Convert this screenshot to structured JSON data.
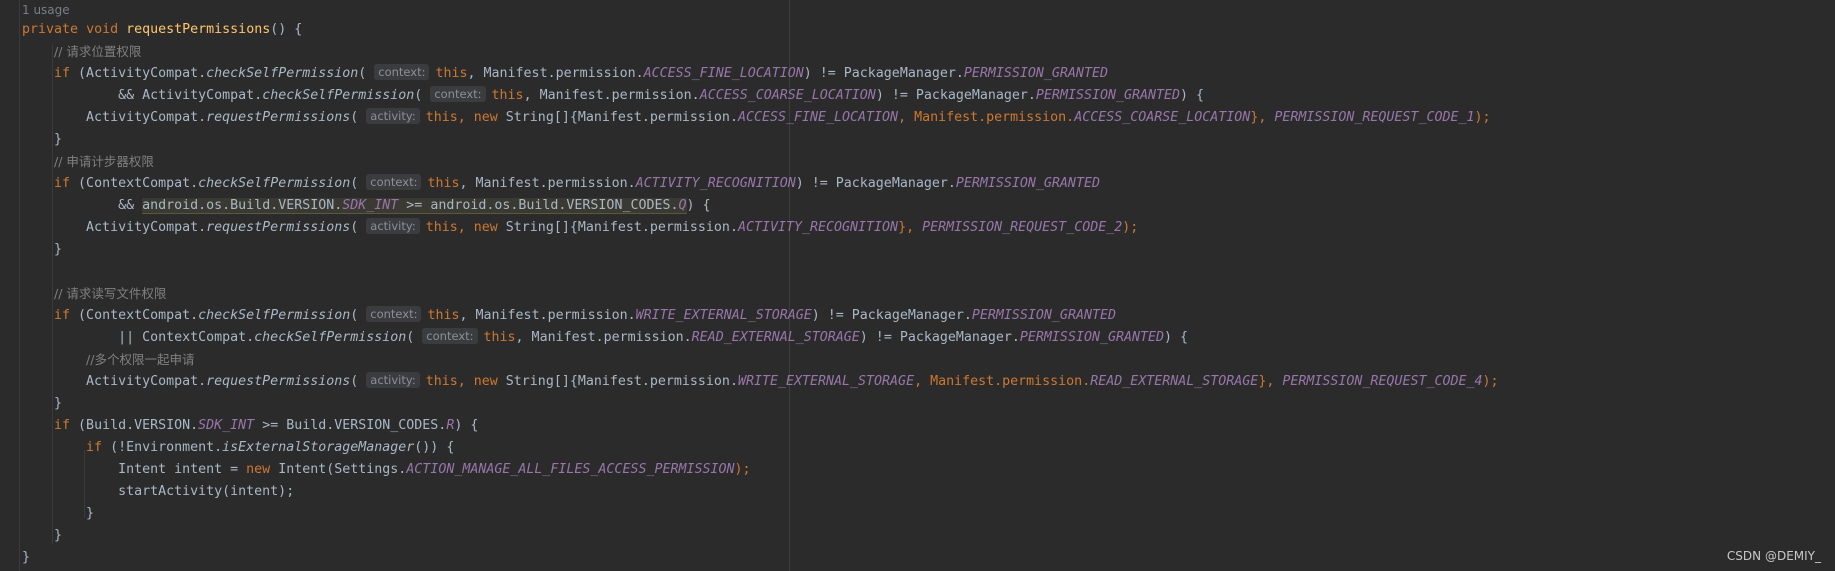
{
  "editor": {
    "usage_hint": "1 usage",
    "watermark": "CSDN @DEMIY_"
  },
  "code": {
    "l1": {
      "kw1": "private",
      "sp1": " ",
      "kw2": "void",
      "sp2": " ",
      "fn": "requestPermissions",
      "rest": "() {"
    },
    "l2": {
      "indent": "    ",
      "comment": "// 请求位置权限"
    },
    "l3": {
      "indent": "    ",
      "kw": "if",
      "t1": " (ActivityCompat.",
      "m1": "checkSelfPermission",
      "t2": "( ",
      "hint": "context:",
      "kw2": "this",
      "t3": ", Manifest.permission.",
      "c1": "ACCESS_FINE_LOCATION",
      "t4": ") != PackageManager.",
      "c2": "PERMISSION_GRANTED"
    },
    "l4": {
      "indent": "            ",
      "t1": "&& ActivityCompat.",
      "m1": "checkSelfPermission",
      "t2": "( ",
      "hint": "context:",
      "kw2": "this",
      "t3": ", Manifest.permission.",
      "c1": "ACCESS_COARSE_LOCATION",
      "t4": ") != PackageManager.",
      "c2": "PERMISSION_GRANTED",
      "t5": ") {"
    },
    "l5": {
      "indent": "        ",
      "t1": "ActivityCompat.",
      "m1": "requestPermissions",
      "t2": "( ",
      "hint": "activity:",
      "kw2": "this",
      "t3": ", ",
      "kw3": "new",
      "t4": " String[]{Manifest.permission.",
      "c1": "ACCESS_FINE_LOCATION",
      "t5": ", Manifest.permission.",
      "c2": "ACCESS_COARSE_LOCATION",
      "t6": "}, ",
      "c3": "PERMISSION_REQUEST_CODE_1",
      "t7": ");"
    },
    "l6": {
      "text": "    }"
    },
    "l7": {
      "indent": "    ",
      "comment": "// 申请计步器权限"
    },
    "l8": {
      "indent": "    ",
      "kw": "if",
      "t1": " (ContextCompat.",
      "m1": "checkSelfPermission",
      "t2": "( ",
      "hint": "context:",
      "kw2": "this",
      "t3": ", Manifest.permission.",
      "c1": "ACTIVITY_RECOGNITION",
      "t4": ") != PackageManager.",
      "c2": "PERMISSION_GRANTED"
    },
    "l9": {
      "indent": "            ",
      "t1": "&& ",
      "h1": "android.os.Build.VERSION.",
      "h2": "SDK_INT",
      "h3": " >= android.os.Build.VERSION_CODES.",
      "h4": "Q",
      "t2": ") {"
    },
    "l10": {
      "indent": "        ",
      "t1": "ActivityCompat.",
      "m1": "requestPermissions",
      "t2": "( ",
      "hint": "activity:",
      "kw2": "this",
      "t3": ", ",
      "kw3": "new",
      "t4": " String[]{Manifest.permission.",
      "c1": "ACTIVITY_RECOGNITION",
      "t5": "}, ",
      "c2": "PERMISSION_REQUEST_CODE_2",
      "t6": ");"
    },
    "l11": {
      "text": "    }"
    },
    "l12": {
      "indent": "    ",
      "comment": "// 请求读写文件权限"
    },
    "l13": {
      "indent": "    ",
      "kw": "if",
      "t1": " (ContextCompat.",
      "m1": "checkSelfPermission",
      "t2": "( ",
      "hint": "context:",
      "kw2": "this",
      "t3": ", Manifest.permission.",
      "c1": "WRITE_EXTERNAL_STORAGE",
      "t4": ") != PackageManager.",
      "c2": "PERMISSION_GRANTED"
    },
    "l14": {
      "indent": "            ",
      "t1": "|| ContextCompat.",
      "m1": "checkSelfPermission",
      "t2": "( ",
      "hint": "context:",
      "kw2": "this",
      "t3": ", Manifest.permission.",
      "c1": "READ_EXTERNAL_STORAGE",
      "t4": ") != PackageManager.",
      "c2": "PERMISSION_GRANTED",
      "t5": ") {"
    },
    "l15": {
      "indent": "        ",
      "comment": "//多个权限一起申请"
    },
    "l16": {
      "indent": "        ",
      "t1": "ActivityCompat.",
      "m1": "requestPermissions",
      "t2": "( ",
      "hint": "activity:",
      "kw2": "this",
      "t3": ", ",
      "kw3": "new",
      "t4": " String[]{Manifest.permission.",
      "c1": "WRITE_EXTERNAL_STORAGE",
      "t5": ", Manifest.permission.",
      "c2": "READ_EXTERNAL_STORAGE",
      "t6": "}, ",
      "c3": "PERMISSION_REQUEST_CODE_4",
      "t7": ");"
    },
    "l17": {
      "text": "    }"
    },
    "l18": {
      "indent": "    ",
      "kw": "if",
      "t1": " (Build.VERSION.",
      "c1": "SDK_INT",
      "t2": " >= Build.VERSION_CODES.",
      "c2": "R",
      "t3": ") {"
    },
    "l19": {
      "indent": "        ",
      "kw": "if",
      "t1": " (!Environment.",
      "m1": "isExternalStorageManager",
      "t2": "()) {"
    },
    "l20": {
      "indent": "            ",
      "t1": "Intent intent = ",
      "kw": "new",
      "t2": " Intent(Settings.",
      "c1": "ACTION_MANAGE_ALL_FILES_ACCESS_PERMISSION",
      "t3": ");"
    },
    "l21": {
      "indent": "            ",
      "t1": "startActivity(intent);"
    },
    "l22": {
      "text": "        }"
    },
    "l23": {
      "text": "    }"
    },
    "l24": {
      "text": "}"
    }
  }
}
